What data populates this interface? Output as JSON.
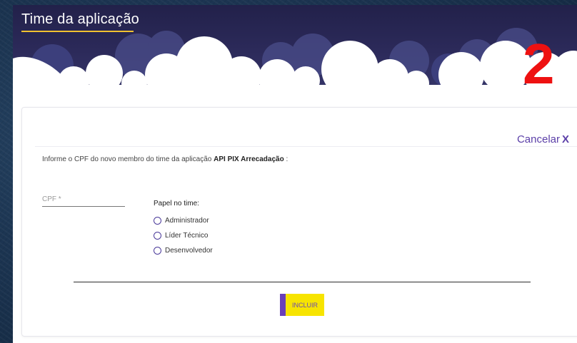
{
  "header": {
    "title": "Time da aplicação",
    "step_number": "2"
  },
  "form": {
    "cancel_label": "Cancelar",
    "cancel_icon": "X",
    "info_prefix": "Informe o CPF do novo membro do time da aplicação",
    "app_name": "API PIX Arrecadação",
    "info_suffix": " :",
    "cpf_placeholder": "CPF *",
    "role_label": "Papel no time:",
    "roles": [
      {
        "label": "Administrador",
        "selected": false
      },
      {
        "label": "Líder Técnico",
        "selected": false
      },
      {
        "label": "Desenvolvedor",
        "selected": false
      }
    ],
    "submit_label": "INCLUIR"
  },
  "colors": {
    "header_bg": "#2c2a5a",
    "title_underline": "#f2c230",
    "step_number": "#ee1111",
    "accent_purple": "#6a3fb8",
    "button_yellow": "#f7e400"
  }
}
